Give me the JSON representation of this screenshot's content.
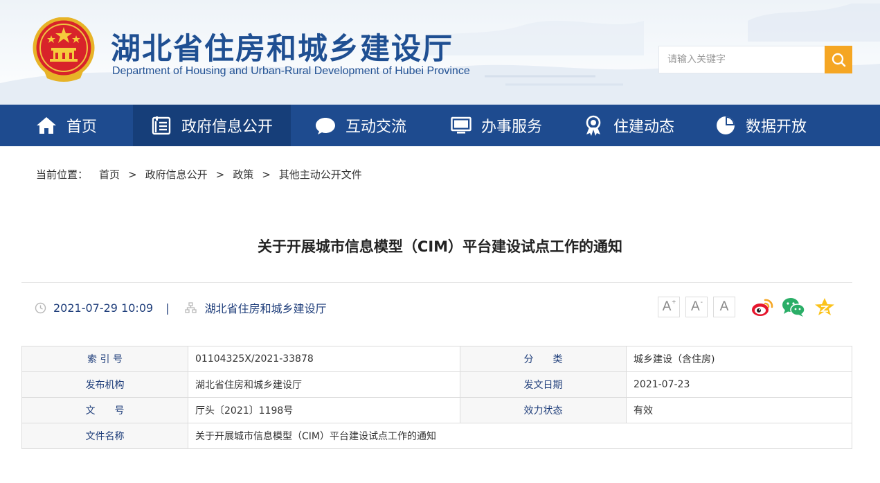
{
  "header": {
    "title": "湖北省住房和城乡建设厅",
    "subtitle": "Department of Housing and Urban-Rural Development of Hubei Province",
    "search_placeholder": "请输入关键字",
    "emblem_icon": "national-emblem-icon",
    "search_icon": "search-icon"
  },
  "colors": {
    "brand_blue": "#1e4b8f",
    "nav_active": "#163e79",
    "search_orange": "#f5a623",
    "text_dark_blue": "#1e3d7a"
  },
  "nav": {
    "items": [
      {
        "label": "首页",
        "icon": "home-icon"
      },
      {
        "label": "政府信息公开",
        "icon": "document-list-icon"
      },
      {
        "label": "互动交流",
        "icon": "chat-bubble-icon"
      },
      {
        "label": "办事服务",
        "icon": "monitor-icon"
      },
      {
        "label": "住建动态",
        "icon": "award-icon"
      },
      {
        "label": "数据开放",
        "icon": "pie-chart-icon"
      }
    ],
    "active_index": 1
  },
  "breadcrumb": {
    "label": "当前位置：",
    "items": [
      "首页",
      "政府信息公开",
      "政策",
      "其他主动公开文件"
    ],
    "separator": ">"
  },
  "article": {
    "title": "关于开展城市信息模型（CIM）平台建设试点工作的通知",
    "datetime": "2021-07-29 10:09",
    "meta_separator": "|",
    "source": "湖北省住房和城乡建设厅",
    "font_sizes": {
      "large": "A",
      "large_sup": "+",
      "small": "A",
      "small_sup": "-",
      "default": "A"
    },
    "share_icons": [
      "weibo-icon",
      "wechat-icon",
      "qzone-icon"
    ]
  },
  "info_table": {
    "rows": [
      {
        "k1": "索 引 号",
        "v1": "01104325X/2021-33878",
        "k2": "分　　类",
        "v2": "城乡建设（含住房)"
      },
      {
        "k1": "发布机构",
        "v1": "湖北省住房和城乡建设厅",
        "k2": "发文日期",
        "v2": "2021-07-23"
      },
      {
        "k1": "文　　号",
        "v1": "厅头〔2021〕1198号",
        "k2": "效力状态",
        "v2": "有效"
      },
      {
        "k1": "文件名称",
        "v1": "关于开展城市信息模型（CIM）平台建设试点工作的通知"
      }
    ]
  }
}
